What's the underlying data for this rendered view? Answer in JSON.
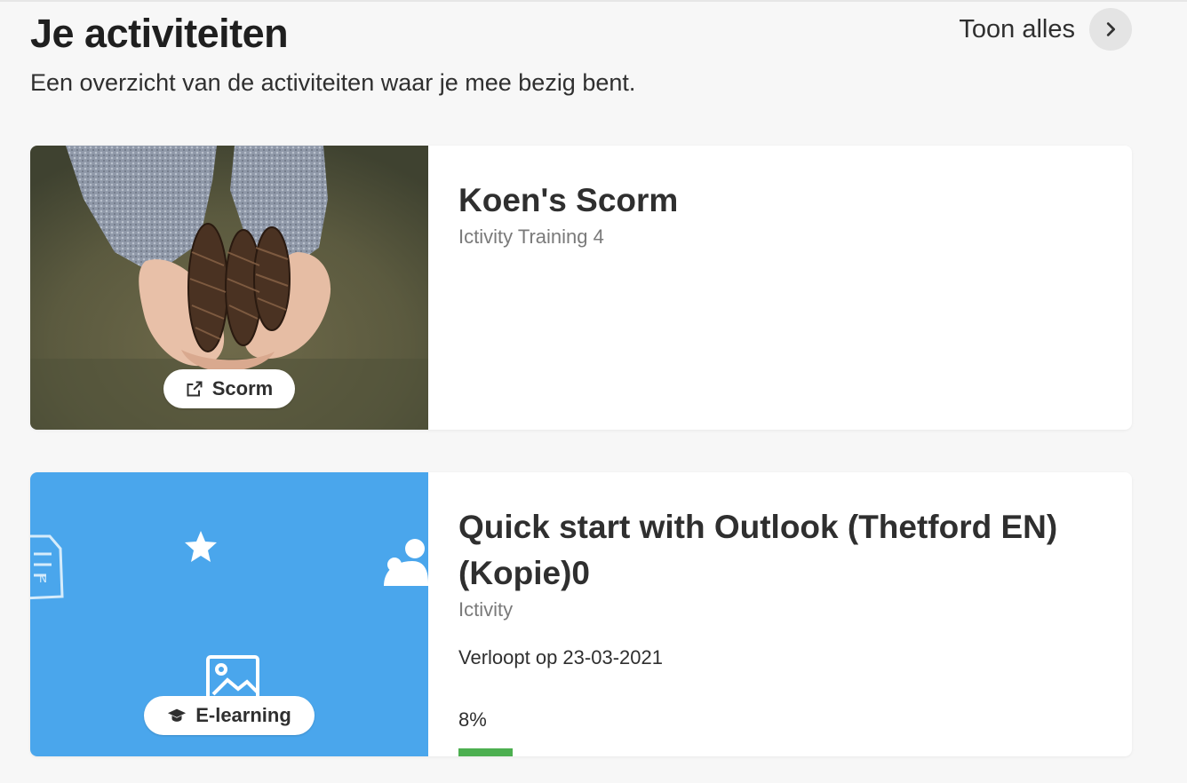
{
  "header": {
    "title": "Je activiteiten",
    "subtitle": "Een overzicht van de activiteiten waar je mee bezig bent.",
    "show_all_label": "Toon alles"
  },
  "activities": [
    {
      "title": "Koen's Scorm",
      "organization": "Ictivity Training 4",
      "type_label": "Scorm",
      "type_icon": "external-link-icon"
    },
    {
      "title": "Quick start with Outlook (Thetford EN) (Kopie)0",
      "organization": "Ictivity",
      "type_label": "E-learning",
      "type_icon": "graduation-cap-icon",
      "expiry": "Verloopt op 23-03-2021",
      "progress_label": "8%",
      "progress": 0.08,
      "thumb_color": "#4aa6ec"
    }
  ],
  "colors": {
    "background": "#f7f7f7",
    "card": "#ffffff",
    "progress": "#4caf50",
    "elearning_thumb": "#4aa6ec"
  }
}
